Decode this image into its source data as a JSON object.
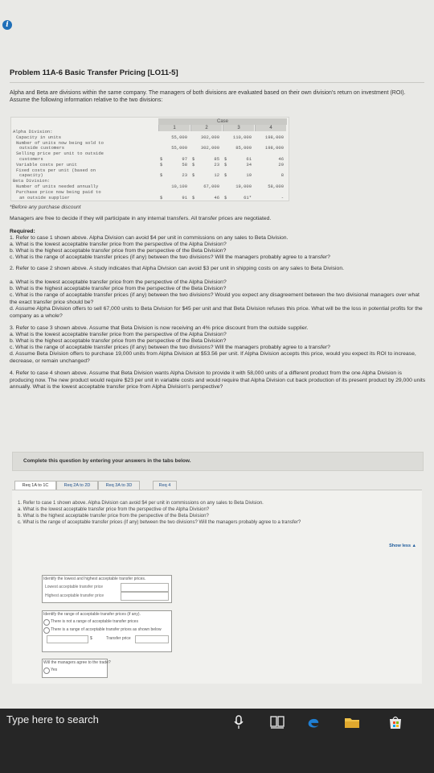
{
  "problem": {
    "title": "Problem 11A-6 Basic Transfer Pricing [LO11-5]",
    "intro": "Alpha and Beta are divisions within the same company. The managers of both divisions are evaluated based on their own division's return on investment (ROI). Assume the following information relative to the two divisions:"
  },
  "table": {
    "case_label": "Case",
    "cases": [
      "1",
      "2",
      "3",
      "4"
    ],
    "rows": [
      {
        "label": "Alpha Division:",
        "vals": [
          "",
          "",
          "",
          ""
        ]
      },
      {
        "label": "Capacity in units",
        "vals": [
          "55,000",
          "302,000",
          "110,000",
          "198,000"
        ]
      },
      {
        "label": "Number of units now being sold to",
        "vals": [
          "",
          "",
          "",
          ""
        ]
      },
      {
        "label": "outside customers",
        "vals": [
          "55,000",
          "302,000",
          "85,000",
          "198,000"
        ]
      },
      {
        "label": "Selling price per unit to outside",
        "vals": [
          "",
          "",
          "",
          ""
        ]
      },
      {
        "label": "customers",
        "vals": [
          "97",
          "85",
          "61",
          "46"
        ]
      },
      {
        "label": "Variable costs per unit",
        "vals": [
          "58",
          "23",
          "34",
          "29"
        ]
      },
      {
        "label": "Fixed costs per unit (based on",
        "vals": [
          "",
          "",
          "",
          ""
        ]
      },
      {
        "label": "capacity)",
        "vals": [
          "23",
          "12",
          "19",
          "8"
        ]
      },
      {
        "label": "Beta Division:",
        "vals": [
          "",
          "",
          "",
          ""
        ]
      },
      {
        "label": "Number of units needed annually",
        "vals": [
          "10,100",
          "67,000",
          "19,000",
          "58,000"
        ]
      },
      {
        "label": "Purchase price now being paid to",
        "vals": [
          "",
          "",
          "",
          ""
        ]
      },
      {
        "label": "an outside supplier",
        "vals": [
          "91",
          "46",
          "61*",
          "-"
        ]
      }
    ],
    "dollar": "$"
  },
  "footnote": "*Before any purchase discount",
  "managers": "Managers are free to decide if they will participate in any internal transfers. All transfer prices are negotiated.",
  "required": {
    "heading": "Required:",
    "q1": "1. Refer to case 1 shown above. Alpha Division can avoid $4 per unit in commissions on any sales to Beta Division.",
    "q1a": "a. What is the lowest acceptable transfer price from the perspective of the Alpha Division?",
    "q1b": "b. What is the highest acceptable transfer price from the perspective of the Beta Division?",
    "q1c": "c. What is the range of acceptable transfer prices (if any) between the two divisions? Will the managers probably agree to a transfer?",
    "q2": "2. Refer to case 2 shown above. A study indicates that Alpha Division can avoid $3 per unit in shipping costs on any sales to Beta Division.",
    "q2a": "a. What is the lowest acceptable transfer price from the perspective of the Alpha Division?",
    "q2b": "b. What is the highest acceptable transfer price from the perspective of the Beta Division?",
    "q2c": "c. What is the range of acceptable transfer prices (if any) between the two divisions? Would you expect any disagreement between the two divisional managers over what the exact transfer price should be?",
    "q2d": "d. Assume Alpha Division offers to sell 67,000 units to Beta Division for $45 per unit and that Beta Division refuses this price. What will be the loss in potential profits for the company as a whole?",
    "q3": "3. Refer to case 3 shown above. Assume that Beta Division is now receiving an 4% price discount from the outside supplier.",
    "q3a": "a. What is the lowest acceptable transfer price from the perspective of the Alpha Division?",
    "q3b": "b. What is the highest acceptable transfer price from the perspective of the Beta Division?",
    "q3c": "c. What is the range of acceptable transfer prices (if any) between the two divisions? Will the managers probably agree to a transfer?",
    "q3d": "d. Assume Beta Division offers to purchase 19,000 units from Alpha Division at $53.56 per unit. If Alpha Division accepts this price, would you expect its ROI to increase, decrease, or remain unchanged?",
    "q4": "4. Refer to case 4 shown above. Assume that Beta Division wants Alpha Division to provide it with 58,000 units of a different product from the one Alpha Division is producing now. The new product would require $23 per unit in variable costs and would require that Alpha Division cut back production of its present product by 29,000 units annually. What is the lowest acceptable transfer price from Alpha Division's perspective?"
  },
  "complete_bar": "Complete this question by entering your answers in the tabs below.",
  "tabs": [
    "Req 1A to 1C",
    "Req 2A to 2D",
    "Req 3A to 3D",
    "Req 4"
  ],
  "panel": {
    "line1": "1. Refer to case 1 shown above. Alpha Division can avoid $4 per unit in commissions on any sales to Beta Division.",
    "line2": "a. What is the lowest acceptable transfer price from the perspective of the Alpha Division?",
    "line3": "b. What is the highest acceptable transfer price from the perspective of the Beta Division?",
    "line4": "c. What is the range of acceptable transfer prices (if any) between the two divisions? Will the managers probably agree to a transfer?",
    "show_less": "Show less ▲",
    "box1_title": "Identify the lowest and highest acceptable transfer prices.",
    "box1_row1": "Lowest acceptable transfer price",
    "box1_row2": "Highest acceptable transfer price",
    "box2_title": "Identify the range of acceptable transfer prices (if any).",
    "box2_opt1": "There is not a range of acceptable transfer prices",
    "box2_opt2": "There is a range of acceptable transfer prices as shown below",
    "box2_dollar": "$",
    "box2_transfer": "Transfer price",
    "box3_title": "Will the managers agree to the trade?",
    "box3_opt1": "Yes"
  },
  "taskbar": {
    "search_placeholder": "Type here to search"
  }
}
